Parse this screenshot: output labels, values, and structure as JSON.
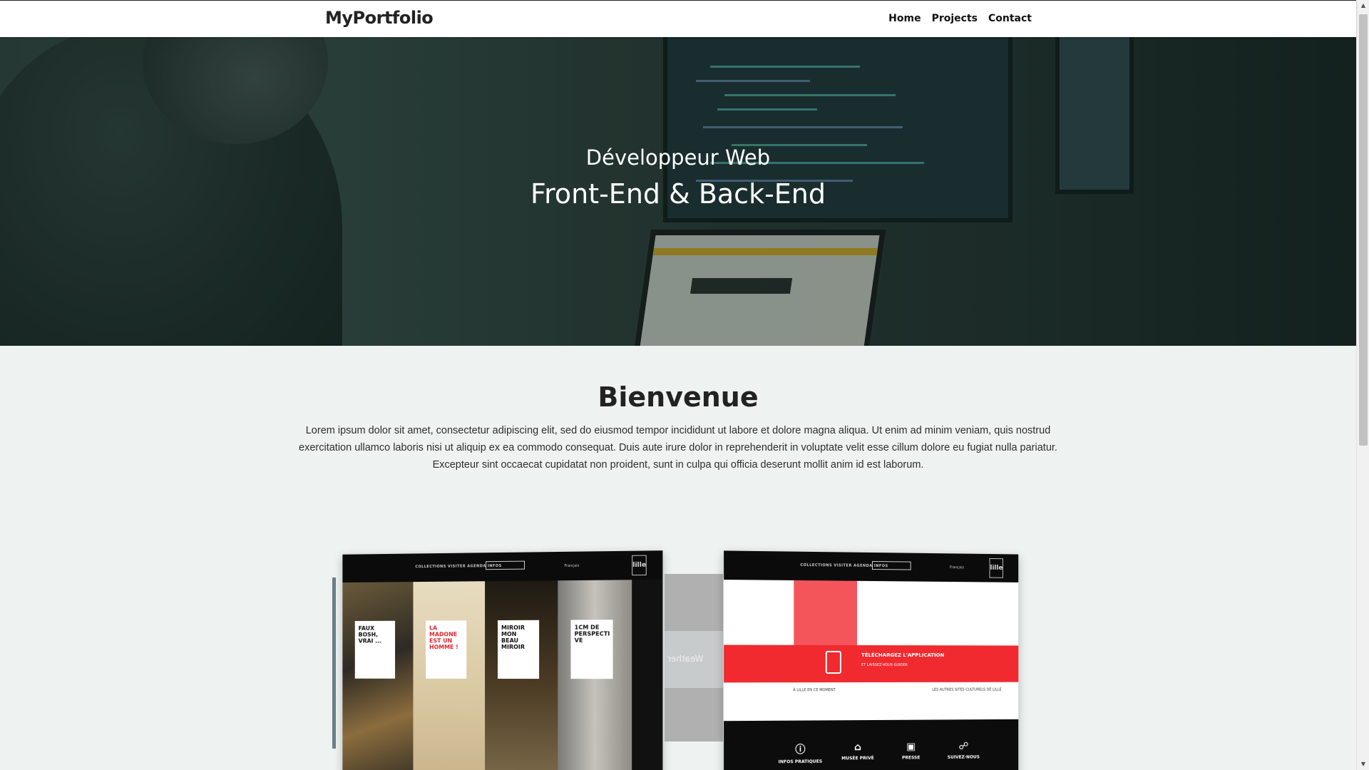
{
  "nav": {
    "brand": "MyPortfolio",
    "links": [
      "Home",
      "Projects",
      "Contact"
    ]
  },
  "hero": {
    "subtitle": "Développeur Web",
    "title": "Front-End & Back-End"
  },
  "welcome": {
    "title": "Bienvenue",
    "text": "Lorem ipsum dolor sit amet, consectetur adipiscing elit, sed do eiusmod tempor incididunt ut labore et dolore magna aliqua. Ut enim ad minim veniam, quis nostrud exercitation ullamco laboris nisi ut aliquip ex ea commodo consequat. Duis aute irure dolor in reprehenderit in voluptate velit esse cillum dolore eu fugiat nulla pariatur. Excepteur sint occaecat cupidatat non proident, sunt in culpa qui officia deserunt mollit anim id est laborum."
  },
  "carousel": {
    "left_card": {
      "menu": "COLLECTIONS  VISITER  AGENDA  INFOS",
      "lang": "Français",
      "logo": "lille",
      "panels": [
        "FAUX BOSH, VRAI ...",
        "LA MADONE EST UN HOMME !",
        "MIROIR MON BEAU MIROIR",
        "1CM DE PERSPECTI VE"
      ]
    },
    "middle_card": {
      "label": "Weather"
    },
    "right_card": {
      "menu": "COLLECTIONS  VISITER  AGENDA  INFOS",
      "lang": "Français",
      "logo": "lille",
      "banner_title": "TÉLÉCHARGEZ L'APPLICATION",
      "banner_sub": "ET LAISSEZ-VOUS GUIDER",
      "info_left": "À LILLE EN CE MOMENT",
      "info_right": "LES AUTRES SITES CULTURELS DE LILLE",
      "footer_items": [
        "INFOS PRATIQUES",
        "MUSÉE PRIVÉ",
        "PRESSE",
        "SUIVEZ-NOUS"
      ]
    }
  },
  "colors": {
    "accent_red": "#f02a2f",
    "hero_tint": "#2c3a37"
  }
}
